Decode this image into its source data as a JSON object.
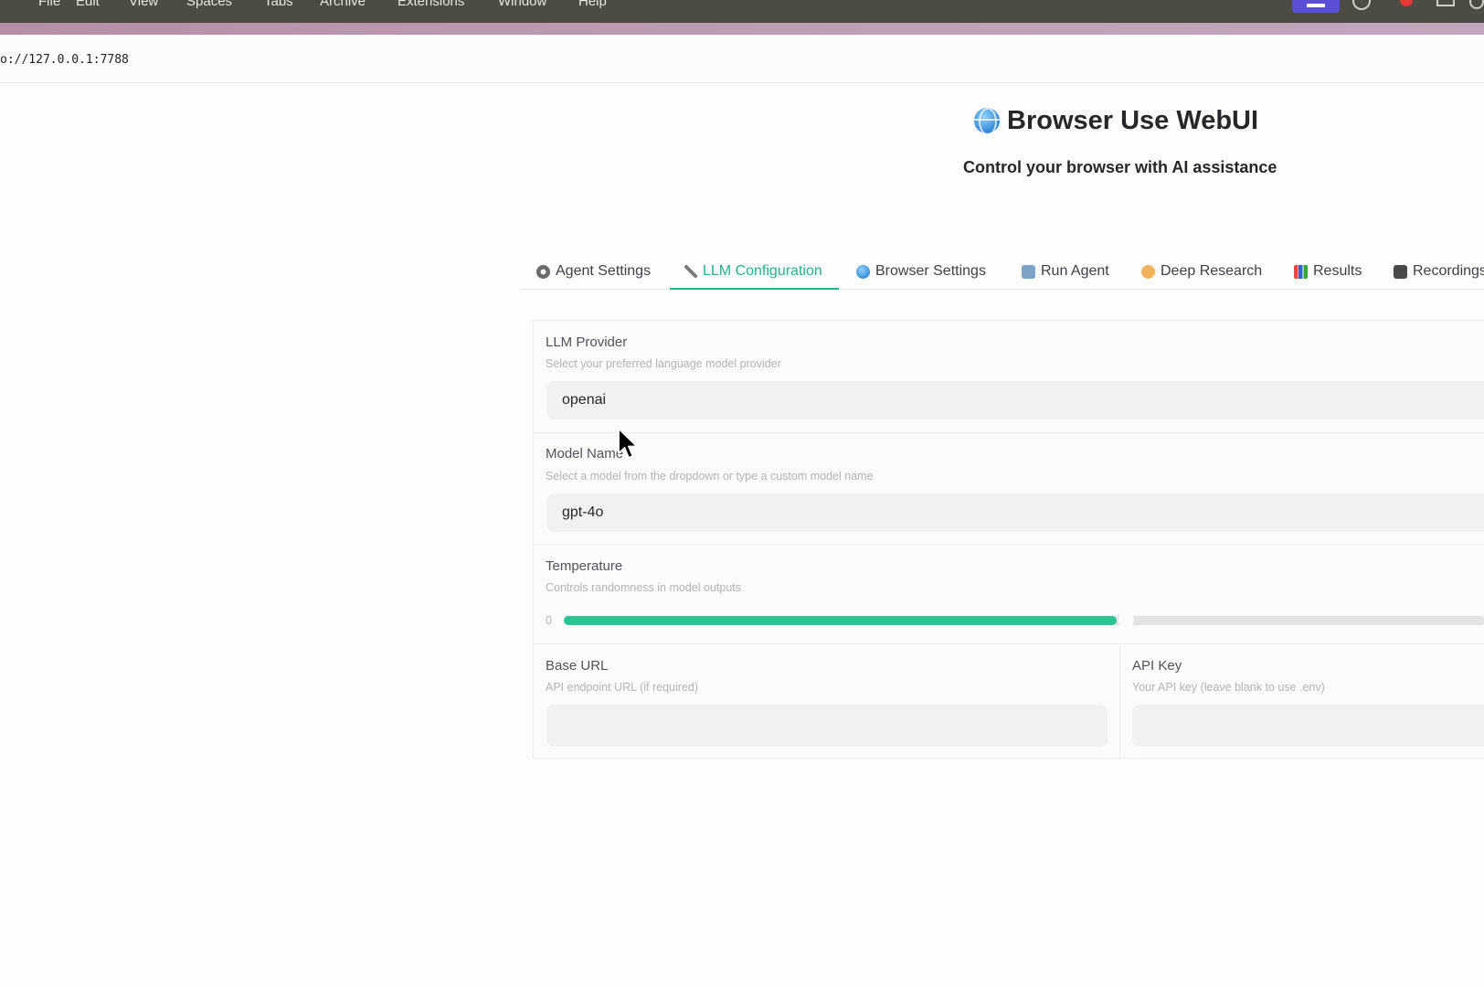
{
  "os_menu": {
    "items": [
      "File",
      "Edit",
      "View",
      "Spaces",
      "Tabs",
      "Archive",
      "Extensions",
      "Window",
      "Help"
    ]
  },
  "browser": {
    "url": "o://127.0.0.1:7788"
  },
  "header": {
    "title": "Browser Use WebUI",
    "subtitle": "Control your browser with AI assistance"
  },
  "tabs": [
    {
      "label": "Agent Settings",
      "icon": "gear-icon"
    },
    {
      "label": "LLM Configuration",
      "icon": "wrench-icon",
      "active": true
    },
    {
      "label": "Browser Settings",
      "icon": "globe-icon"
    },
    {
      "label": "Run Agent",
      "icon": "robot-icon"
    },
    {
      "label": "Deep Research",
      "icon": "brain-icon"
    },
    {
      "label": "Results",
      "icon": "chart-icon"
    },
    {
      "label": "Recordings",
      "icon": "camera-icon"
    }
  ],
  "llm": {
    "provider": {
      "label": "LLM Provider",
      "info": "Select your preferred language model provider",
      "value": "openai"
    },
    "model": {
      "label": "Model Name",
      "info": "Select a model from the dropdown or type a custom model name",
      "value": "gpt-4o"
    },
    "temperature": {
      "label": "Temperature",
      "info": "Controls randomness in model outputs",
      "min_label": "0",
      "fill_fraction": 0.6
    },
    "base_url": {
      "label": "Base URL",
      "info": "API endpoint URL (if required)",
      "value": ""
    },
    "api_key": {
      "label": "API Key",
      "info": "Your API key (leave blank to use .env)",
      "value": ""
    }
  },
  "colors": {
    "accent": "#23b488",
    "slider_fill": "#2cc393"
  }
}
